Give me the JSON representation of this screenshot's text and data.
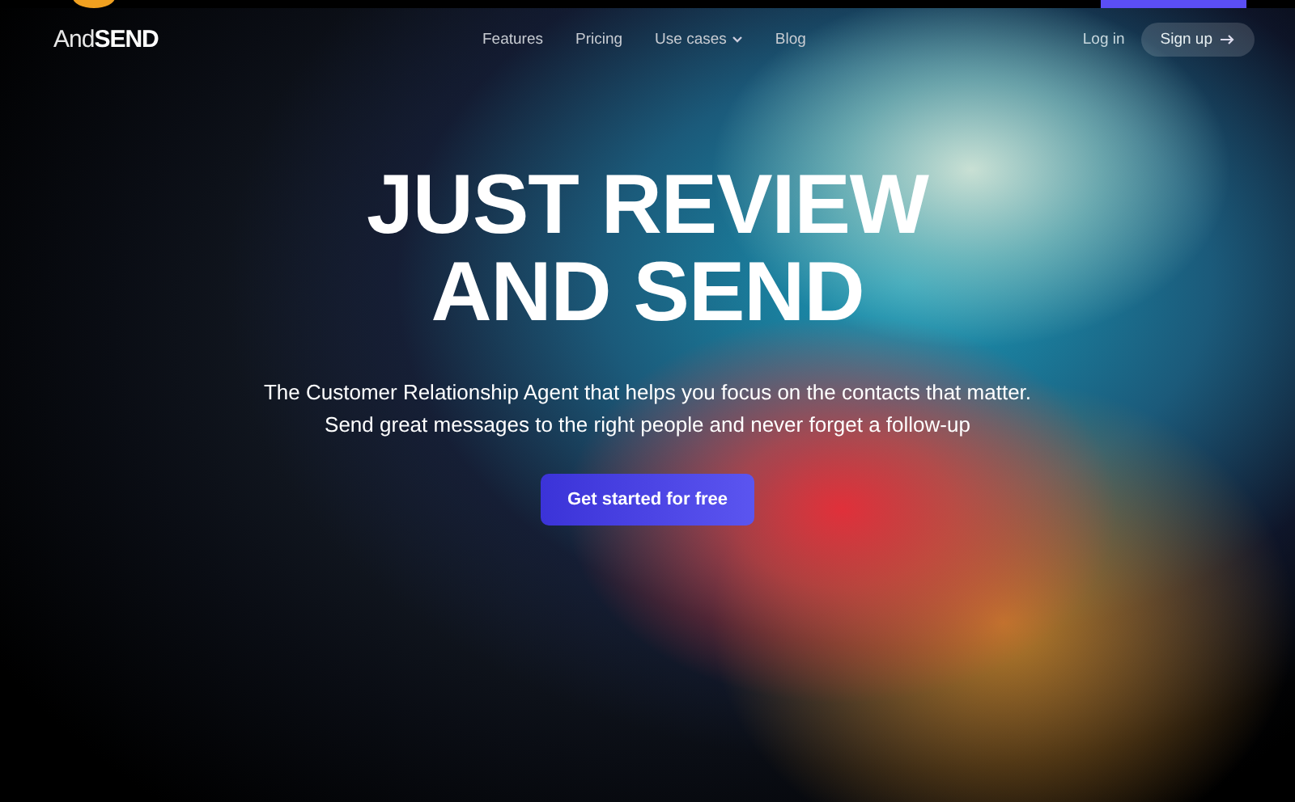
{
  "nav": {
    "logo": {
      "light": "And",
      "bold": "SEND"
    },
    "links": [
      {
        "label": "Features",
        "kind": "link"
      },
      {
        "label": "Pricing",
        "kind": "link"
      },
      {
        "label": "Use cases",
        "kind": "dropdown"
      },
      {
        "label": "Blog",
        "kind": "link"
      }
    ],
    "login": "Log in",
    "signup": "Sign up"
  },
  "hero": {
    "title_lines": [
      "JUST REVIEW",
      "AND SEND"
    ],
    "subtitle_lines": [
      "The Customer Relationship Agent that helps you focus on the contacts that matter.",
      "Send great messages to the right people and never forget a follow-up"
    ],
    "cta": "Get started for free"
  }
}
